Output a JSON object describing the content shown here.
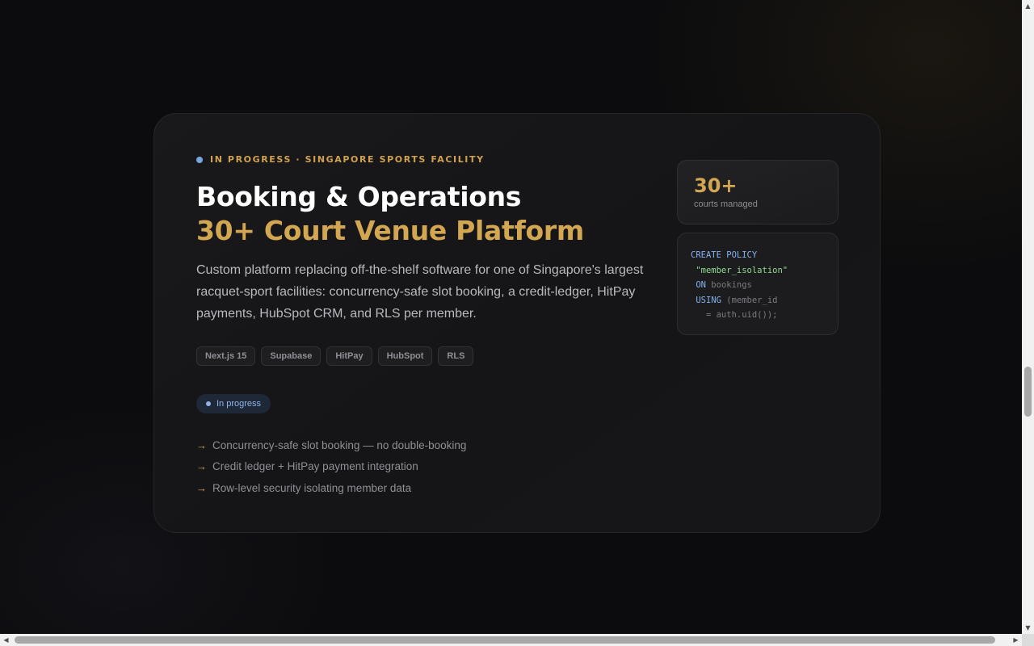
{
  "project": {
    "eyebrow": "IN PROGRESS · SINGAPORE SPORTS FACILITY",
    "title_line1": "Booking & Operations",
    "title_line2": "30+ Court Venue Platform",
    "description": "Custom platform replacing off-the-shelf software for one of Singapore's largest racquet-sport facilities: concurrency-safe slot booking, a credit-ledger, HitPay payments, HubSpot CRM, and RLS per member.",
    "tags": [
      "Next.js 15",
      "Supabase",
      "HitPay",
      "HubSpot",
      "RLS"
    ],
    "status": "In progress",
    "highlights": [
      "Concurrency-safe slot booking — no double-booking",
      "Credit ledger + HitPay payment integration",
      "Row-level security isolating member data"
    ],
    "stat": {
      "value": "30+",
      "label": "courts managed"
    },
    "code": {
      "l1": "CREATE POLICY",
      "l2": "\"member_isolation\"",
      "l3_kw": "ON",
      "l3_rest": " bookings",
      "l4_kw": "USING",
      "l4_rest": " (member_id",
      "l5": "  = auth.uid());"
    }
  },
  "colors": {
    "accent_gold": "#d3a752",
    "status_blue": "#8fb4ec",
    "background": "#0c0c0e"
  },
  "icons": {
    "eyebrow": "dot-icon",
    "bullet": "arrow-right-icon"
  }
}
